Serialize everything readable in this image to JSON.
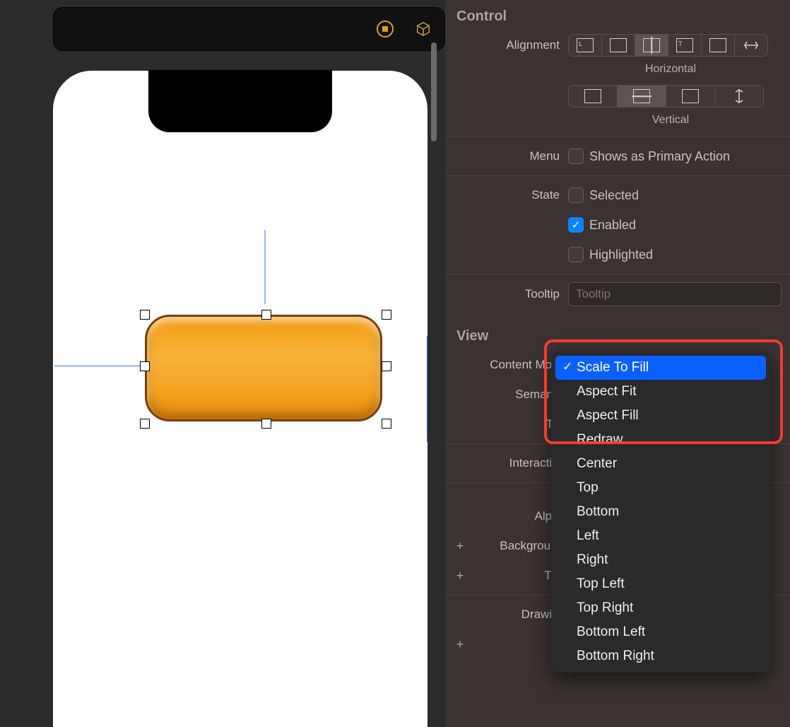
{
  "inspector": {
    "control": {
      "title": "Control",
      "alignment_label": "Alignment",
      "horizontal_label": "Horizontal",
      "vertical_label": "Vertical",
      "menu_label": "Menu",
      "menu_option": "Shows as Primary Action",
      "state_label": "State",
      "state_selected": "Selected",
      "state_enabled": "Enabled",
      "state_highlighted": "Highlighted",
      "tooltip_label": "Tooltip",
      "tooltip_placeholder": "Tooltip"
    },
    "view": {
      "title": "View",
      "content_mode_label": "Content Mode",
      "semantic_label": "Semantic",
      "tag_label": "Tag",
      "interaction_label": "Interaction",
      "alpha_label": "Alpha",
      "background_label": "Background",
      "tint_label": "Tint",
      "drawing_label": "Drawing"
    }
  },
  "dropdown": {
    "selected": "Scale To Fill",
    "items": [
      "Scale To Fill",
      "Aspect Fit",
      "Aspect Fill",
      "Redraw",
      "Center",
      "Top",
      "Bottom",
      "Left",
      "Right",
      "Top Left",
      "Top Right",
      "Bottom Left",
      "Bottom Right"
    ]
  }
}
